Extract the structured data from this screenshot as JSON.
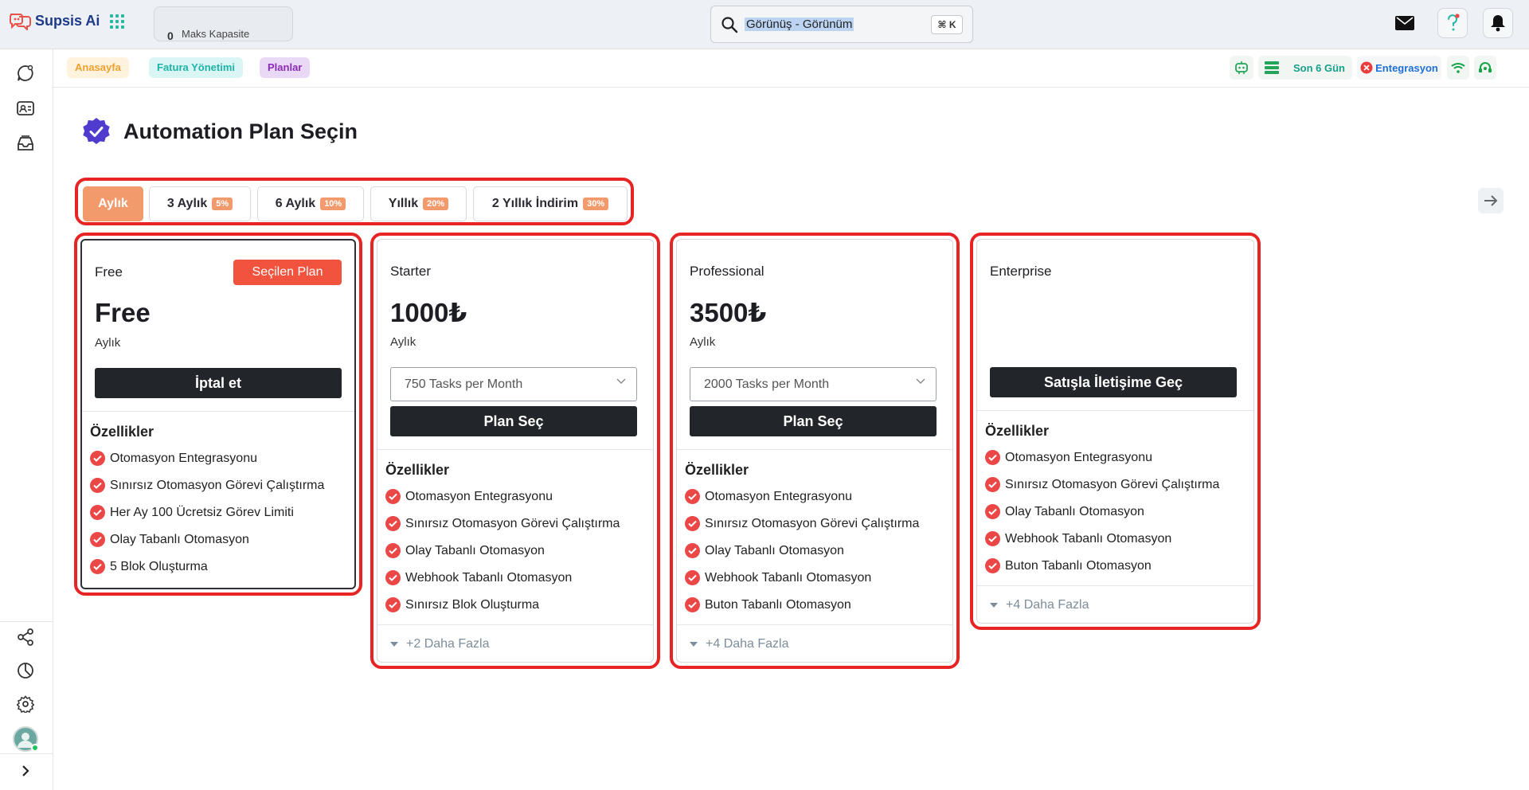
{
  "app": {
    "name": "Supsis Ai"
  },
  "capacity": {
    "value": "0",
    "label": "Maks Kapasite"
  },
  "search": {
    "text": "Görünüş - Görünüm",
    "shortcut": "⌘ K"
  },
  "breadcrumbs": [
    "Anasayfa",
    "Fatura Yönetimi",
    "Planlar"
  ],
  "status": {
    "period": "Son 6 Gün",
    "integration": "Entegrasyon"
  },
  "page": {
    "title": "Automation Plan Seçin"
  },
  "periods": [
    {
      "label": "Aylık",
      "discount": ""
    },
    {
      "label": "3 Aylık",
      "discount": "5%"
    },
    {
      "label": "6 Aylık",
      "discount": "10%"
    },
    {
      "label": "Yıllık",
      "discount": "20%"
    },
    {
      "label": "2 Yıllık İndirim",
      "discount": "30%"
    }
  ],
  "plans": [
    {
      "name": "Free",
      "badge": "Seçilen Plan",
      "price": "Free",
      "period": "Aylık",
      "button": "İptal et",
      "features_title": "Özellikler",
      "features": [
        "Otomasyon Entegrasyonu",
        "Sınırsız Otomasyon Görevi Çalıştırma",
        "Her Ay 100 Ücretsiz Görev Limiti",
        "Olay Tabanlı Otomasyon",
        "5 Blok Oluşturma"
      ]
    },
    {
      "name": "Starter",
      "price": "1000₺",
      "period": "Aylık",
      "select_value": "750 Tasks per Month",
      "button": "Plan Seç",
      "features_title": "Özellikler",
      "features": [
        "Otomasyon Entegrasyonu",
        "Sınırsız Otomasyon Görevi Çalıştırma",
        "Olay Tabanlı Otomasyon",
        "Webhook Tabanlı Otomasyon",
        "Sınırsız Blok Oluşturma"
      ],
      "more": "+2 Daha Fazla"
    },
    {
      "name": "Professional",
      "price": "3500₺",
      "period": "Aylık",
      "select_value": "2000 Tasks per Month",
      "button": "Plan Seç",
      "features_title": "Özellikler",
      "features": [
        "Otomasyon Entegrasyonu",
        "Sınırsız Otomasyon Görevi Çalıştırma",
        "Olay Tabanlı Otomasyon",
        "Webhook Tabanlı Otomasyon",
        "Buton Tabanlı Otomasyon"
      ],
      "more": "+4 Daha Fazla"
    },
    {
      "name": "Enterprise",
      "button": "Satışla İletişime Geç",
      "features_title": "Özellikler",
      "features": [
        "Otomasyon Entegrasyonu",
        "Sınırsız Otomasyon Görevi Çalıştırma",
        "Olay Tabanlı Otomasyon",
        "Webhook Tabanlı Otomasyon",
        "Buton Tabanlı Otomasyon"
      ],
      "more": "+4 Daha Fazla"
    }
  ],
  "colors": {
    "accent": "#f39a6d",
    "highlight": "#e82323",
    "badge": "#f2533e",
    "dark_button": "#22252a",
    "check": "#ec4747"
  },
  "icons": [
    "logo-icon",
    "apps-grid-icon",
    "search-icon",
    "mail-icon",
    "help-icon",
    "bell-icon",
    "chat-icon",
    "contacts-icon",
    "inbox-icon",
    "share-icon",
    "chart-icon",
    "gear-icon",
    "chevron-right-icon",
    "bot-icon",
    "list-icon",
    "error-icon",
    "wifi-icon",
    "headset-icon",
    "verified-badge-icon",
    "arrow-right-icon",
    "chevron-down-icon",
    "check-icon",
    "caret-down-icon"
  ]
}
